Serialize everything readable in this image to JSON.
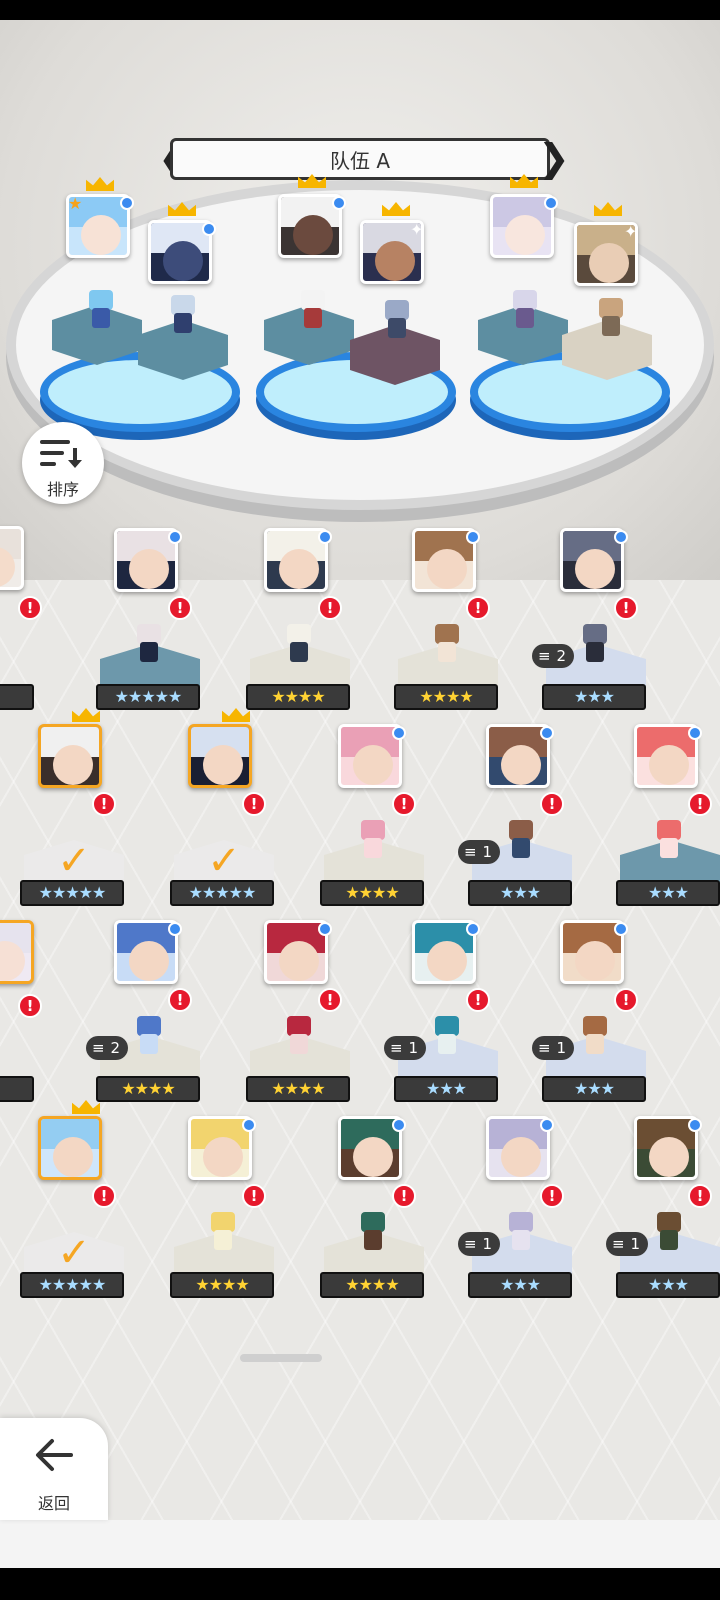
{
  "team": {
    "title": "队伍 A",
    "prev_arrow": "❮",
    "next_arrow": "❯"
  },
  "sort_button": {
    "label": "排序"
  },
  "back_button": {
    "label": "返回"
  },
  "icons": {
    "alert": "!",
    "check": "✓",
    "crown": "crown-icon",
    "dot": "blue-dot-icon"
  },
  "colors": {
    "alert_red": "#e6192c",
    "crown_gold": "#f7b500",
    "selected_orange": "#f5a623",
    "team_slot_blue": "#2a85e0",
    "star_gold": "#ffd233",
    "star_blue": "#a9dcff"
  },
  "roster": [
    {
      "stars": "★★★★★",
      "star_color": "blue",
      "dup": "",
      "selected": false
    },
    {
      "stars": "★★★★",
      "star_color": "gold",
      "dup": "",
      "selected": false
    },
    {
      "stars": "★★★★",
      "star_color": "gold",
      "dup": "",
      "selected": false
    },
    {
      "stars": "★★★",
      "star_color": "blue",
      "dup": "2",
      "selected": false
    },
    {
      "stars": "★★★★★",
      "star_color": "blue",
      "dup": "",
      "selected": true
    },
    {
      "stars": "★★★★★",
      "star_color": "blue",
      "dup": "",
      "selected": true
    },
    {
      "stars": "★★★★",
      "star_color": "gold",
      "dup": "",
      "selected": false
    },
    {
      "stars": "★★★",
      "star_color": "blue",
      "dup": "1",
      "selected": false
    },
    {
      "stars": "★★★",
      "star_color": "blue",
      "dup": "",
      "selected": false
    },
    {
      "stars": "★★★★",
      "star_color": "gold",
      "dup": "2",
      "selected": false
    },
    {
      "stars": "★★★★",
      "star_color": "gold",
      "dup": "",
      "selected": false
    },
    {
      "stars": "★★★",
      "star_color": "blue",
      "dup": "1",
      "selected": false
    },
    {
      "stars": "★★★",
      "star_color": "blue",
      "dup": "1",
      "selected": false
    },
    {
      "stars": "★★★★★",
      "star_color": "blue",
      "dup": "",
      "selected": true
    },
    {
      "stars": "★★★★",
      "star_color": "gold",
      "dup": "",
      "selected": false
    },
    {
      "stars": "★★★★",
      "star_color": "gold",
      "dup": "",
      "selected": false
    },
    {
      "stars": "★★★",
      "star_color": "blue",
      "dup": "1",
      "selected": false
    },
    {
      "stars": "★★★",
      "star_color": "blue",
      "dup": "1",
      "selected": false
    }
  ],
  "partial_left": [
    {
      "stars": "★★",
      "star_color": "blue"
    },
    {
      "stars": "★★",
      "star_color": "blue"
    }
  ],
  "dup_labels": [
    "2",
    "1",
    "2",
    "1",
    "1",
    "1",
    "1"
  ]
}
